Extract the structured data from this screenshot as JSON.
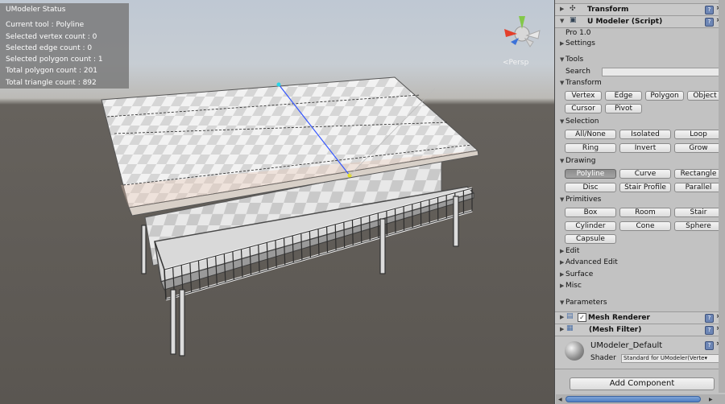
{
  "status_overlay": {
    "title": "UModeler Status",
    "lines": [
      "Current tool : Polyline",
      "Selected vertex count : 0",
      "Selected edge count : 0",
      "Selected polygon count : 1",
      "Total polygon count : 201",
      "Total triangle count : 892"
    ]
  },
  "scene": {
    "projection_label": "<Persp"
  },
  "inspector": {
    "transform_header": "Transform",
    "script_header": "U Modeler (Script)",
    "version": "Pro 1.0",
    "settings": "Settings",
    "tools": "Tools",
    "search_label": "Search",
    "search_value": "",
    "transform_section": "Transform",
    "transform_buttons": [
      "Vertex",
      "Edge",
      "Polygon",
      "Object",
      "Cursor",
      "Pivot"
    ],
    "selection_section": "Selection",
    "selection_buttons": [
      "All/None",
      "Isolated",
      "Loop",
      "Ring",
      "Invert",
      "Grow"
    ],
    "drawing_section": "Drawing",
    "drawing_buttons": [
      "Polyline",
      "Curve",
      "Rectangle",
      "Disc",
      "Stair Profile",
      "Parallel"
    ],
    "drawing_active": "Polyline",
    "primitives_section": "Primitives",
    "primitive_buttons": [
      "Box",
      "Room",
      "Stair",
      "Cylinder",
      "Cone",
      "Sphere",
      "Capsule"
    ],
    "collapsed_sections": [
      "Edit",
      "Advanced Edit",
      "Surface",
      "Misc"
    ],
    "parameters": "Parameters",
    "mesh_renderer": "Mesh Renderer",
    "mesh_renderer_enabled": true,
    "mesh_filter": "(Mesh Filter)",
    "material_name": "UModeler_Default",
    "shader_label": "Shader",
    "shader_value": "Standard for UModeler(Verte▾",
    "add_component": "Add Component"
  }
}
